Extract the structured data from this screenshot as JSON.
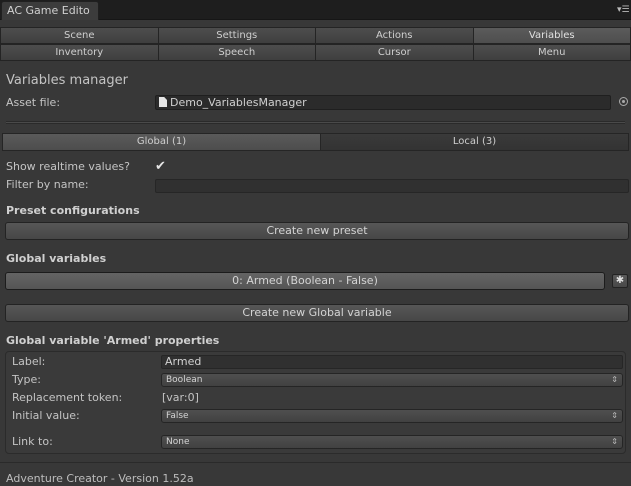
{
  "window": {
    "tab_title": "AC Game Edito",
    "menu_icon": "menu-icon"
  },
  "tabs": {
    "row1": [
      "Scene",
      "Settings",
      "Actions",
      "Variables"
    ],
    "row2": [
      "Inventory",
      "Speech",
      "Cursor",
      "Menu"
    ],
    "active": "Variables"
  },
  "manager": {
    "title": "Variables manager",
    "asset_label": "Asset file:",
    "asset_value": "Demo_VariablesManager",
    "asset_icon": "document-icon",
    "picker_icon": "object-picker-icon"
  },
  "scope_tabs": {
    "global": "Global (1)",
    "local": "Local (3)",
    "active": "global"
  },
  "filters": {
    "realtime_label": "Show realtime values?",
    "realtime_checked": true,
    "filter_label": "Filter by name:",
    "filter_value": ""
  },
  "presets": {
    "heading": "Preset configurations",
    "create_button": "Create new preset"
  },
  "global_vars": {
    "heading": "Global variables",
    "items": [
      "0: Armed (Boolean - False)"
    ],
    "gear_icon": "gear-icon",
    "create_button": "Create new Global variable"
  },
  "properties": {
    "heading": "Global variable 'Armed' properties",
    "label_label": "Label:",
    "label_value": "Armed",
    "type_label": "Type:",
    "type_value": "Boolean",
    "token_label": "Replacement token:",
    "token_value": "[var:0]",
    "initial_label": "Initial value:",
    "initial_value": "False",
    "link_label": "Link to:",
    "link_value": "None"
  },
  "footer": {
    "version": "Adventure Creator - Version 1.52a"
  }
}
